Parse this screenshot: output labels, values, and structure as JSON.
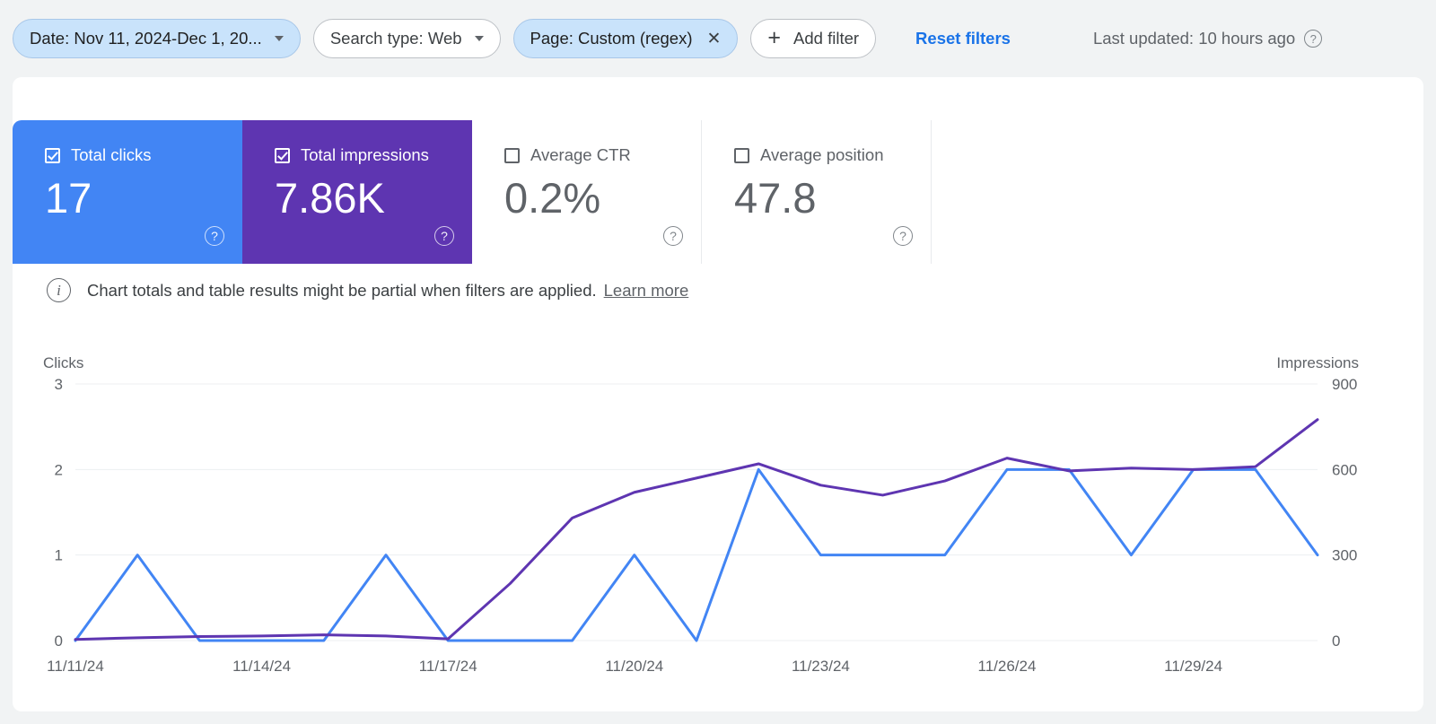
{
  "toolbar": {
    "filters": [
      {
        "id": "date",
        "label": "Date: Nov 11, 2024-Dec 1, 20...",
        "active": true,
        "control": "caret"
      },
      {
        "id": "search-type",
        "label": "Search type: Web",
        "active": false,
        "control": "caret"
      },
      {
        "id": "page",
        "label": "Page: Custom (regex)",
        "active": true,
        "control": "close"
      }
    ],
    "add_filter_label": "Add filter",
    "add_filter_icon": "plus-icon",
    "reset_label": "Reset filters",
    "last_updated": "Last updated: 10 hours ago",
    "help_icon": "help-circle-icon"
  },
  "metrics": [
    {
      "id": "total-clicks",
      "label": "Total clicks",
      "value": "17",
      "checked": true,
      "style": "sel-clicks",
      "color": "#4285f4"
    },
    {
      "id": "total-impressions",
      "label": "Total impressions",
      "value": "7.86K",
      "checked": true,
      "style": "sel-impr",
      "color": "#5e35b1"
    },
    {
      "id": "average-ctr",
      "label": "Average CTR",
      "value": "0.2%",
      "checked": false,
      "style": "plain",
      "color": "#5f6368"
    },
    {
      "id": "average-position",
      "label": "Average position",
      "value": "47.8",
      "checked": false,
      "style": "plain",
      "color": "#5f6368"
    }
  ],
  "banner": {
    "icon": "info-icon",
    "text": "Chart totals and table results might be partial when filters are applied.",
    "link": "Learn more"
  },
  "chart_data": {
    "type": "line",
    "title": "",
    "xlabel": "",
    "grid": true,
    "legend": "none",
    "x": [
      "11/11/24",
      "11/12/24",
      "11/13/24",
      "11/14/24",
      "11/15/24",
      "11/16/24",
      "11/17/24",
      "11/18/24",
      "11/19/24",
      "11/20/24",
      "11/21/24",
      "11/22/24",
      "11/23/24",
      "11/24/24",
      "11/25/24",
      "11/26/24",
      "11/27/24",
      "11/28/24",
      "11/29/24",
      "11/30/24",
      "12/01/24"
    ],
    "x_tick_labels": [
      "11/11/24",
      "11/14/24",
      "11/17/24",
      "11/20/24",
      "11/23/24",
      "11/26/24",
      "11/29/24"
    ],
    "x_tick_indices": [
      0,
      3,
      6,
      9,
      12,
      15,
      18
    ],
    "axes": [
      {
        "id": "left",
        "name": "Clicks",
        "ticks": [
          0,
          1,
          2,
          3
        ],
        "tick_labels": [
          "0",
          "1",
          "2",
          "3"
        ],
        "limits": [
          0,
          3
        ]
      },
      {
        "id": "right",
        "name": "Impressions",
        "ticks": [
          0,
          300,
          600,
          900
        ],
        "tick_labels": [
          "0",
          "300",
          "600",
          "900"
        ],
        "limits": [
          0,
          900
        ]
      }
    ],
    "series": [
      {
        "name": "Clicks",
        "axis": "left",
        "color": "#4285f4",
        "values": [
          0,
          1,
          0,
          0,
          0,
          1,
          0,
          0,
          0,
          1,
          0,
          2,
          1,
          1,
          1,
          2,
          2,
          1,
          2,
          2,
          1
        ]
      },
      {
        "name": "Impressions",
        "axis": "right",
        "color": "#5e35b1",
        "values": [
          4,
          10,
          14,
          16,
          20,
          16,
          6,
          200,
          430,
          520,
          570,
          620,
          545,
          510,
          560,
          640,
          595,
          605,
          600,
          610,
          775
        ]
      }
    ]
  }
}
